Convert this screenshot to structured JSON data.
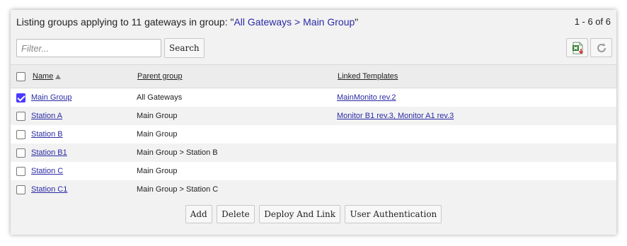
{
  "header": {
    "prefix": "Listing groups applying to 11 gateways in group: \"",
    "group_path_link": "All Gateways > Main Group",
    "suffix": "\"",
    "pager": "1 - 6 of 6"
  },
  "filter": {
    "placeholder": "Filter...",
    "value": ""
  },
  "toolbar": {
    "search_label": "Search",
    "export_icon": "excel-export-icon",
    "refresh_icon": "refresh-icon"
  },
  "table": {
    "columns": {
      "name": "Name",
      "parent": "Parent group",
      "linked": "Linked Templates"
    },
    "sort": {
      "column": "name",
      "direction": "ascending"
    },
    "rows": [
      {
        "checked": true,
        "name": "Main Group",
        "parent": "All Gateways",
        "linked": "MainMonito rev.2"
      },
      {
        "checked": false,
        "name": "Station A",
        "parent": "Main Group",
        "linked": "Monitor B1 rev.3, Monitor A1 rev.3"
      },
      {
        "checked": false,
        "name": "Station B",
        "parent": "Main Group",
        "linked": ""
      },
      {
        "checked": false,
        "name": "Station B1",
        "parent": "Main Group > Station B",
        "linked": ""
      },
      {
        "checked": false,
        "name": "Station C",
        "parent": "Main Group",
        "linked": ""
      },
      {
        "checked": false,
        "name": "Station C1",
        "parent": "Main Group > Station C",
        "linked": ""
      }
    ]
  },
  "actions": {
    "add": "Add",
    "delete": "Delete",
    "deploy": "Deploy And Link",
    "auth": "User Authentication"
  },
  "colors": {
    "link": "#2a2aa5",
    "checkbox_accent": "#4a3aff",
    "panel_bg": "#f2f2f2"
  }
}
